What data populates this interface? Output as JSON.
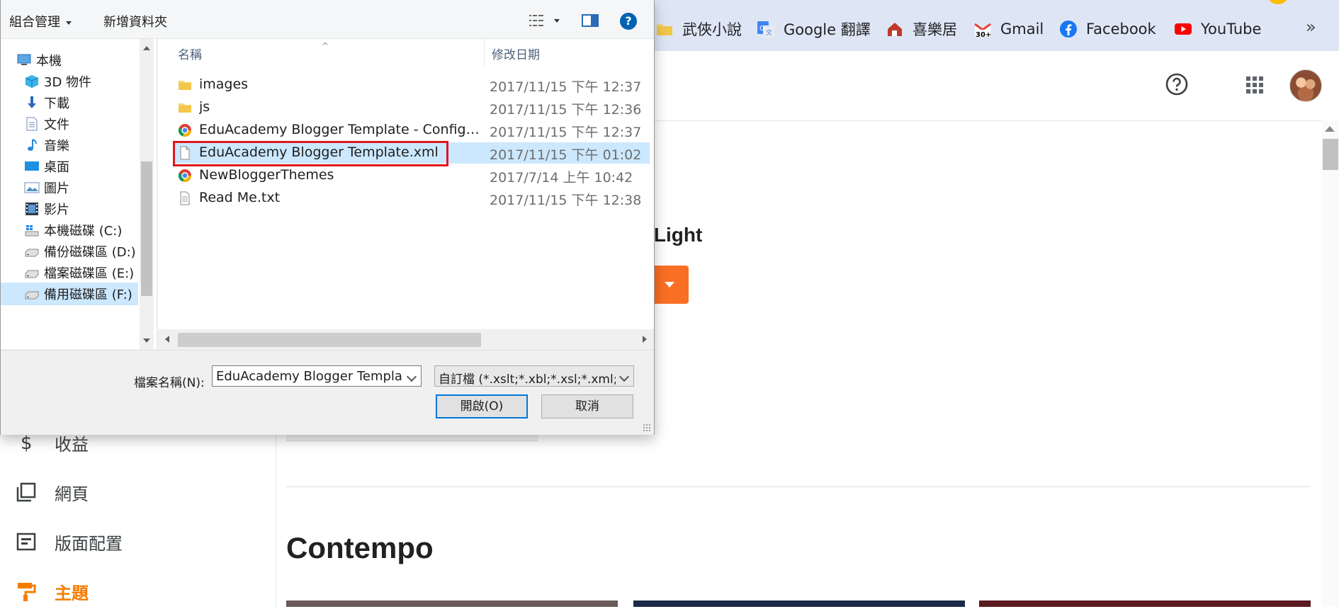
{
  "browser": {
    "bookmarks": [
      {
        "label": "武俠小說",
        "icon": "folder-icon"
      },
      {
        "label": "Google 翻譯",
        "icon": "google-translate-icon"
      },
      {
        "label": "喜樂居",
        "icon": "house-icon"
      },
      {
        "label": "Gmail",
        "icon": "gmail-icon",
        "badge": "30+"
      },
      {
        "label": "Facebook",
        "icon": "facebook-icon"
      },
      {
        "label": "YouTube",
        "icon": "youtube-icon"
      }
    ],
    "overflow_label": "»"
  },
  "blogger": {
    "sidebar": [
      {
        "label": "收益",
        "icon": "dollar-icon",
        "active": false
      },
      {
        "label": "網頁",
        "icon": "pages-icon",
        "active": false
      },
      {
        "label": "版面配置",
        "icon": "layout-icon",
        "active": false
      },
      {
        "label": "主題",
        "icon": "theme-roller-icon",
        "active": true
      }
    ],
    "theme_heading_partial": "o Light",
    "section_title": "Contempo",
    "accent_color": "#f57c00",
    "button_color": "#fb6f24"
  },
  "dialog": {
    "toolbar": {
      "organize": "組合管理",
      "new_folder": "新增資料夾",
      "help": "?"
    },
    "nav_items": [
      {
        "label": "本機",
        "icon": "computer-icon",
        "indent": 1
      },
      {
        "label": "3D 物件",
        "icon": "3d-objects-icon",
        "indent": 2
      },
      {
        "label": "下載",
        "icon": "download-icon",
        "indent": 2
      },
      {
        "label": "文件",
        "icon": "documents-icon",
        "indent": 2
      },
      {
        "label": "音樂",
        "icon": "music-icon",
        "indent": 2
      },
      {
        "label": "桌面",
        "icon": "desktop-icon",
        "indent": 2
      },
      {
        "label": "圖片",
        "icon": "pictures-icon",
        "indent": 2
      },
      {
        "label": "影片",
        "icon": "videos-icon",
        "indent": 2
      },
      {
        "label": "本機磁碟 (C:)",
        "icon": "windows-drive-icon",
        "indent": 2
      },
      {
        "label": "備份磁碟區 (D:)",
        "icon": "drive-icon",
        "indent": 2
      },
      {
        "label": "檔案磁碟區 (E:)",
        "icon": "drive-icon",
        "indent": 2
      },
      {
        "label": "備用磁碟區 (F:)",
        "icon": "drive-icon",
        "indent": 2
      }
    ],
    "columns": {
      "name": "名稱",
      "modified": "修改日期"
    },
    "files": [
      {
        "name": "images",
        "date": "2017/11/15 下午 12:37",
        "icon": "folder-icon"
      },
      {
        "name": "js",
        "date": "2017/11/15 下午 12:36",
        "icon": "folder-icon"
      },
      {
        "name": "EduAcademy Blogger Template - Configu...",
        "date": "2017/11/15 下午 12:37",
        "icon": "chrome-icon"
      },
      {
        "name": "EduAcademy Blogger Template.xml",
        "date": "2017/11/15 下午 01:02",
        "icon": "document-icon"
      },
      {
        "name": "NewBloggerThemes",
        "date": "2017/7/14 上午 10:42",
        "icon": "chrome-icon"
      },
      {
        "name": "Read Me.txt",
        "date": "2017/11/15 下午 12:38",
        "icon": "text-file-icon"
      }
    ],
    "selected_file_index": 3,
    "filename_label": "檔案名稱(N):",
    "filename_value": "EduAcademy Blogger Template.xml",
    "filter_value": "自訂檔 (*.xslt;*.xbl;*.xsl;*.xml;*.",
    "open_button": "開啟(O)",
    "cancel_button": "取消",
    "highlight_color": "#e0151f",
    "selection_color": "#cce8ff"
  }
}
